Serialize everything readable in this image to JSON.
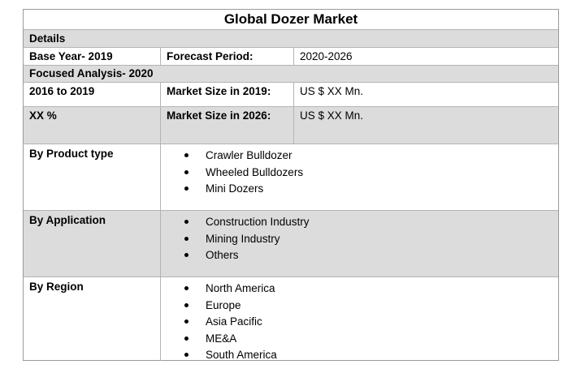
{
  "title": "Global Dozer Market",
  "details_label": "Details",
  "base_year": "Base Year- 2019",
  "forecast_label": "Forecast Period:",
  "forecast_value": "2020-2026",
  "focused_analysis": "Focused Analysis- 2020",
  "period_range": "2016 to 2019",
  "market_size_2019_label": "Market Size in 2019:",
  "market_size_2019_value": "US $ XX Mn.",
  "cagr": "XX %",
  "market_size_2026_label": "Market Size in 2026:",
  "market_size_2026_value": "US $ XX Mn.",
  "segments": {
    "product_type": {
      "label": "By Product type",
      "items": [
        "Crawler Bulldozer",
        "Wheeled Bulldozers",
        "Mini Dozers"
      ]
    },
    "application": {
      "label": "By Application",
      "items": [
        "Construction Industry",
        "Mining Industry",
        "Others"
      ]
    },
    "region": {
      "label": "By Region",
      "items": [
        "North America",
        "Europe",
        "Asia Pacific",
        "ME&A",
        "South America"
      ]
    }
  }
}
